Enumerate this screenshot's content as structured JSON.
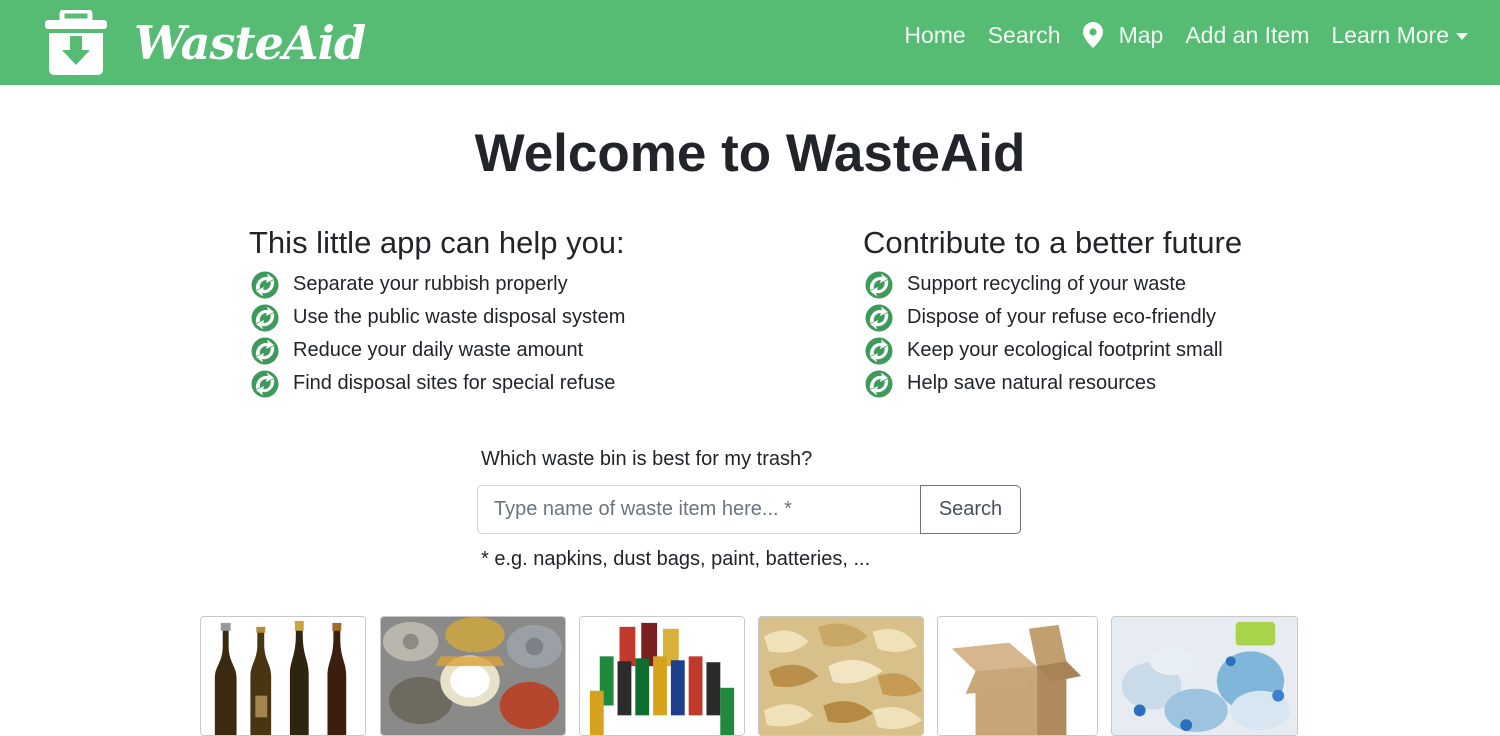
{
  "brand": {
    "name": "WasteAid",
    "logo_icon": "trash-bin-download-icon",
    "color": "#56bb73"
  },
  "nav": {
    "items": [
      {
        "label": "Home"
      },
      {
        "label": "Search"
      },
      {
        "label": "Map",
        "icon": "map-pin-icon"
      },
      {
        "label": "Add an Item"
      },
      {
        "label": "Learn More",
        "icon": "caret-down-icon"
      }
    ]
  },
  "main": {
    "title": "Welcome to WasteAid",
    "left": {
      "heading": "This little app can help you:",
      "items": [
        "Separate your rubbish properly",
        "Use the public waste disposal system",
        "Reduce your daily waste amount",
        "Find disposal sites for special refuse"
      ]
    },
    "right": {
      "heading": "Contribute to a better future",
      "items": [
        "Support recycling of your waste",
        "Dispose of your refuse eco-friendly",
        "Keep your ecological footprint small",
        "Help save natural resources"
      ]
    },
    "bullet_icon": "recycle-arrows-icon",
    "search": {
      "question": "Which waste bin is best for my trash?",
      "placeholder": "Type name of waste item here... *",
      "button_label": "Search",
      "hint": "* e.g. napkins, dust bags, paint, batteries, ..."
    }
  },
  "categories": [
    {
      "image": "glass-bottles"
    },
    {
      "image": "metal-cans"
    },
    {
      "image": "batteries"
    },
    {
      "image": "organic-peels"
    },
    {
      "image": "cardboard-box"
    },
    {
      "image": "plastic-bottles"
    }
  ]
}
